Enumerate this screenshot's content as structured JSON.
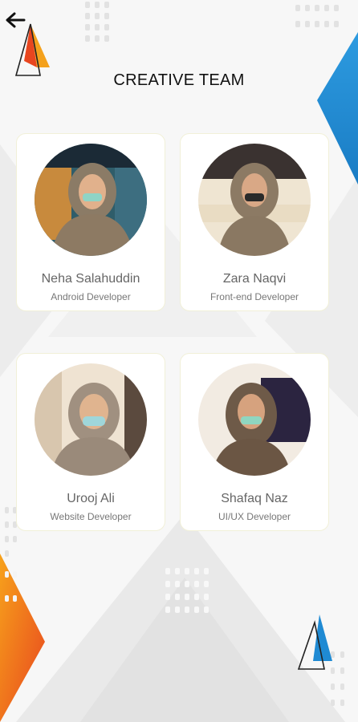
{
  "header": {
    "back_icon": "arrow-left-icon",
    "title": "CREATIVE TEAM"
  },
  "colors": {
    "accent_blue": "#1f8ad3",
    "accent_orange": "#f28c1b",
    "accent_red": "#e8461f"
  },
  "team": [
    {
      "name": "Neha Salahuddin",
      "role": "Android Developer"
    },
    {
      "name": "Zara Naqvi",
      "role": "Front-end Developer"
    },
    {
      "name": "Urooj Ali",
      "role": "Website Developer"
    },
    {
      "name": "Shafaq Naz",
      "role": "UI/UX Developer"
    }
  ]
}
